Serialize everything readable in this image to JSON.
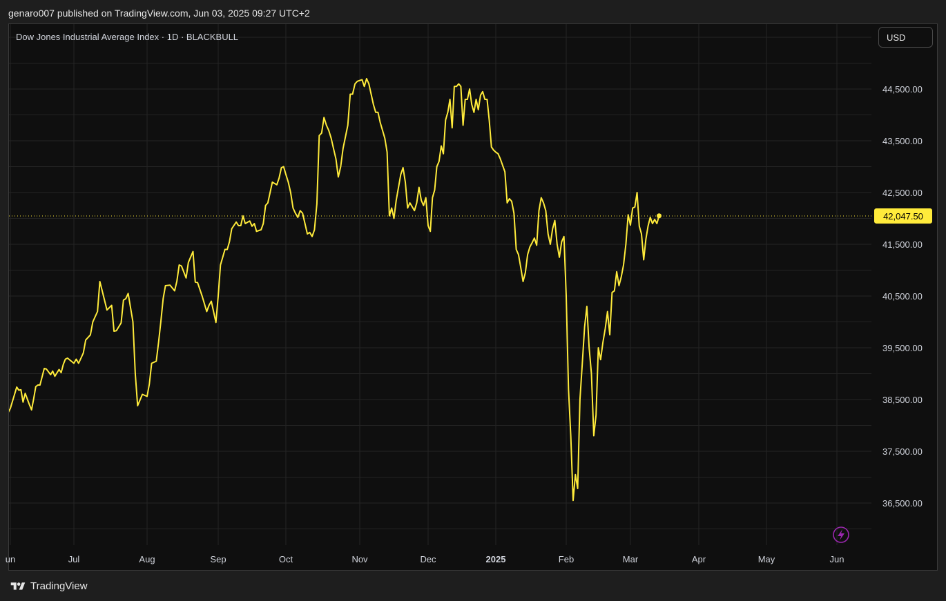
{
  "header": {
    "published_text": "genaro007 published on TradingView.com, Jun 03, 2025 09:27 UTC+2"
  },
  "chart_header": {
    "title": "Dow Jones Industrial Average Index · 1D · BLACKBULL",
    "currency": "USD"
  },
  "footer": {
    "brand": "TradingView",
    "brand_icon": "tradingview-logo-icon"
  },
  "icons": {
    "flash": "lightning-icon"
  },
  "colors": {
    "line": "#ffeb3b",
    "price_label_bg": "#ffeb3b",
    "background": "#0f0f0f",
    "grid": "#242424",
    "flash_icon": "#9c27b0"
  },
  "chart_data": {
    "type": "line",
    "title": "Dow Jones Industrial Average Index · 1D · BLACKBULL",
    "xlabel": "",
    "ylabel": "",
    "x_ticks": [
      {
        "label": "un",
        "date": "2024-06-01"
      },
      {
        "label": "Jul",
        "date": "2024-07-01"
      },
      {
        "label": "Aug",
        "date": "2024-08-01"
      },
      {
        "label": "Sep",
        "date": "2024-09-01"
      },
      {
        "label": "Oct",
        "date": "2024-10-01"
      },
      {
        "label": "Nov",
        "date": "2024-11-01"
      },
      {
        "label": "Dec",
        "date": "2024-12-01"
      },
      {
        "label": "2025",
        "date": "2025-01-01",
        "bold": true
      },
      {
        "label": "Feb",
        "date": "2025-02-01"
      },
      {
        "label": "Mar",
        "date": "2025-03-01"
      },
      {
        "label": "Apr",
        "date": "2025-04-01"
      },
      {
        "label": "May",
        "date": "2025-05-01"
      },
      {
        "label": "Jun",
        "date": "2025-06-01"
      }
    ],
    "y_ticks": [
      36500,
      37500,
      38500,
      39500,
      40500,
      41500,
      42500,
      43500,
      44500
    ],
    "y_tick_labels": [
      "36,500.00",
      "37,500.00",
      "38,500.00",
      "39,500.00",
      "40,500.00",
      "41,500.00",
      "42,500.00",
      "43,500.00",
      "44,500.00"
    ],
    "ylim": [
      35800,
      45800
    ],
    "last_price": 42047.5,
    "last_price_label": "42,047.50",
    "grid": true,
    "series": [
      {
        "points": [
          [
            "2024-05-31",
            38250
          ],
          [
            "2024-06-01",
            38330
          ],
          [
            "2024-06-03",
            38600
          ],
          [
            "2024-06-04",
            38740
          ],
          [
            "2024-06-05",
            38680
          ],
          [
            "2024-06-06",
            38690
          ],
          [
            "2024-06-07",
            38450
          ],
          [
            "2024-06-08",
            38620
          ],
          [
            "2024-06-10",
            38400
          ],
          [
            "2024-06-11",
            38300
          ],
          [
            "2024-06-12",
            38510
          ],
          [
            "2024-06-13",
            38750
          ],
          [
            "2024-06-14",
            38780
          ],
          [
            "2024-06-15",
            38780
          ],
          [
            "2024-06-17",
            39100
          ],
          [
            "2024-06-18",
            39090
          ],
          [
            "2024-06-20",
            38980
          ],
          [
            "2024-06-21",
            39050
          ],
          [
            "2024-06-22",
            38950
          ],
          [
            "2024-06-24",
            39080
          ],
          [
            "2024-06-25",
            39020
          ],
          [
            "2024-06-26",
            39180
          ],
          [
            "2024-06-27",
            39280
          ],
          [
            "2024-06-28",
            39300
          ],
          [
            "2024-07-01",
            39200
          ],
          [
            "2024-07-02",
            39280
          ],
          [
            "2024-07-03",
            39200
          ],
          [
            "2024-07-04",
            39300
          ],
          [
            "2024-07-05",
            39400
          ],
          [
            "2024-07-06",
            39650
          ],
          [
            "2024-07-08",
            39750
          ],
          [
            "2024-07-09",
            40000
          ],
          [
            "2024-07-11",
            40200
          ],
          [
            "2024-07-12",
            40780
          ],
          [
            "2024-07-13",
            40600
          ],
          [
            "2024-07-15",
            40230
          ],
          [
            "2024-07-17",
            40320
          ],
          [
            "2024-07-18",
            39820
          ],
          [
            "2024-07-19",
            39830
          ],
          [
            "2024-07-21",
            39980
          ],
          [
            "2024-07-22",
            40420
          ],
          [
            "2024-07-23",
            40450
          ],
          [
            "2024-07-24",
            40550
          ],
          [
            "2024-07-26",
            40000
          ],
          [
            "2024-07-27",
            39000
          ],
          [
            "2024-07-28",
            38380
          ],
          [
            "2024-07-30",
            38600
          ],
          [
            "2024-08-01",
            38560
          ],
          [
            "2024-08-02",
            38800
          ],
          [
            "2024-08-03",
            39200
          ],
          [
            "2024-08-05",
            39240
          ],
          [
            "2024-08-06",
            39600
          ],
          [
            "2024-08-07",
            40000
          ],
          [
            "2024-08-08",
            40450
          ],
          [
            "2024-08-09",
            40700
          ],
          [
            "2024-08-11",
            40710
          ],
          [
            "2024-08-13",
            40600
          ],
          [
            "2024-08-14",
            40790
          ],
          [
            "2024-08-15",
            41100
          ],
          [
            "2024-08-16",
            41080
          ],
          [
            "2024-08-18",
            40850
          ],
          [
            "2024-08-19",
            41150
          ],
          [
            "2024-08-21",
            41360
          ],
          [
            "2024-08-22",
            40770
          ],
          [
            "2024-08-23",
            40760
          ],
          [
            "2024-08-25",
            40500
          ],
          [
            "2024-08-27",
            40200
          ],
          [
            "2024-08-28",
            40320
          ],
          [
            "2024-08-29",
            40400
          ],
          [
            "2024-08-31",
            39990
          ],
          [
            "2024-09-01",
            40500
          ],
          [
            "2024-09-02",
            41100
          ],
          [
            "2024-09-04",
            41400
          ],
          [
            "2024-09-05",
            41400
          ],
          [
            "2024-09-06",
            41550
          ],
          [
            "2024-09-07",
            41800
          ],
          [
            "2024-09-09",
            41930
          ],
          [
            "2024-09-10",
            41860
          ],
          [
            "2024-09-11",
            41860
          ],
          [
            "2024-09-12",
            42050
          ],
          [
            "2024-09-13",
            41900
          ],
          [
            "2024-09-15",
            41950
          ],
          [
            "2024-09-16",
            41850
          ],
          [
            "2024-09-17",
            41900
          ],
          [
            "2024-09-18",
            41750
          ],
          [
            "2024-09-20",
            41780
          ],
          [
            "2024-09-21",
            41900
          ],
          [
            "2024-09-22",
            42250
          ],
          [
            "2024-09-23",
            42300
          ],
          [
            "2024-09-25",
            42700
          ],
          [
            "2024-09-27",
            42650
          ],
          [
            "2024-09-28",
            42780
          ],
          [
            "2024-09-29",
            42980
          ],
          [
            "2024-09-30",
            43000
          ],
          [
            "2024-10-01",
            42850
          ],
          [
            "2024-10-02",
            42700
          ],
          [
            "2024-10-03",
            42500
          ],
          [
            "2024-10-04",
            42200
          ],
          [
            "2024-10-05",
            42100
          ],
          [
            "2024-10-06",
            42020
          ],
          [
            "2024-10-07",
            42150
          ],
          [
            "2024-10-08",
            42100
          ],
          [
            "2024-10-10",
            41700
          ],
          [
            "2024-10-11",
            41730
          ],
          [
            "2024-10-12",
            41650
          ],
          [
            "2024-10-13",
            41780
          ],
          [
            "2024-10-14",
            42280
          ],
          [
            "2024-10-15",
            43600
          ],
          [
            "2024-10-16",
            43650
          ],
          [
            "2024-10-17",
            43950
          ],
          [
            "2024-10-18",
            43800
          ],
          [
            "2024-10-19",
            43700
          ],
          [
            "2024-10-20",
            43550
          ],
          [
            "2024-10-21",
            43350
          ],
          [
            "2024-10-22",
            43150
          ],
          [
            "2024-10-23",
            42800
          ],
          [
            "2024-10-24",
            43000
          ],
          [
            "2024-10-25",
            43350
          ],
          [
            "2024-10-27",
            43800
          ],
          [
            "2024-10-28",
            44400
          ],
          [
            "2024-10-29",
            44400
          ],
          [
            "2024-10-30",
            44600
          ],
          [
            "2024-10-31",
            44650
          ],
          [
            "2024-11-02",
            44680
          ],
          [
            "2024-11-03",
            44550
          ],
          [
            "2024-11-04",
            44700
          ],
          [
            "2024-11-05",
            44600
          ],
          [
            "2024-11-06",
            44400
          ],
          [
            "2024-11-07",
            44200
          ],
          [
            "2024-11-08",
            44050
          ],
          [
            "2024-11-09",
            44050
          ],
          [
            "2024-11-10",
            43850
          ],
          [
            "2024-11-11",
            43700
          ],
          [
            "2024-11-12",
            43550
          ],
          [
            "2024-11-13",
            43280
          ],
          [
            "2024-11-14",
            42050
          ],
          [
            "2024-11-15",
            42200
          ],
          [
            "2024-11-16",
            42000
          ],
          [
            "2024-11-17",
            42350
          ],
          [
            "2024-11-19",
            42850
          ],
          [
            "2024-11-20",
            42980
          ],
          [
            "2024-11-21",
            42700
          ],
          [
            "2024-11-22",
            42200
          ],
          [
            "2024-11-23",
            42300
          ],
          [
            "2024-11-25",
            42150
          ],
          [
            "2024-11-26",
            42300
          ],
          [
            "2024-11-27",
            42600
          ],
          [
            "2024-11-28",
            42350
          ],
          [
            "2024-11-29",
            42250
          ],
          [
            "2024-11-30",
            42400
          ],
          [
            "2024-12-01",
            41860
          ],
          [
            "2024-12-02",
            41750
          ],
          [
            "2024-12-03",
            42400
          ],
          [
            "2024-12-04",
            42550
          ],
          [
            "2024-12-05",
            43000
          ],
          [
            "2024-12-06",
            43100
          ],
          [
            "2024-12-07",
            43400
          ],
          [
            "2024-12-08",
            43250
          ],
          [
            "2024-12-09",
            43900
          ],
          [
            "2024-12-10",
            44050
          ],
          [
            "2024-12-11",
            44300
          ],
          [
            "2024-12-12",
            43750
          ],
          [
            "2024-12-13",
            44550
          ],
          [
            "2024-12-14",
            44550
          ],
          [
            "2024-12-15",
            44600
          ],
          [
            "2024-12-16",
            44550
          ],
          [
            "2024-12-17",
            43800
          ],
          [
            "2024-12-18",
            44300
          ],
          [
            "2024-12-19",
            44300
          ],
          [
            "2024-12-20",
            44500
          ],
          [
            "2024-12-21",
            44200
          ],
          [
            "2024-12-22",
            44050
          ],
          [
            "2024-12-23",
            44300
          ],
          [
            "2024-12-24",
            44100
          ],
          [
            "2024-12-25",
            44380
          ],
          [
            "2024-12-26",
            44450
          ],
          [
            "2024-12-27",
            44300
          ],
          [
            "2024-12-28",
            44300
          ],
          [
            "2024-12-29",
            43900
          ],
          [
            "2024-12-30",
            43380
          ],
          [
            "2024-12-31",
            43320
          ],
          [
            "2025-01-01",
            43280
          ],
          [
            "2025-01-02",
            43250
          ],
          [
            "2025-01-03",
            43150
          ],
          [
            "2025-01-05",
            42900
          ],
          [
            "2025-01-06",
            42300
          ],
          [
            "2025-01-07",
            42380
          ],
          [
            "2025-01-08",
            42330
          ],
          [
            "2025-01-09",
            42100
          ],
          [
            "2025-01-10",
            41400
          ],
          [
            "2025-01-11",
            41300
          ],
          [
            "2025-01-12",
            41050
          ],
          [
            "2025-01-13",
            40780
          ],
          [
            "2025-01-14",
            40950
          ],
          [
            "2025-01-15",
            41300
          ],
          [
            "2025-01-16",
            41450
          ],
          [
            "2025-01-17",
            41530
          ],
          [
            "2025-01-18",
            41620
          ],
          [
            "2025-01-19",
            41480
          ],
          [
            "2025-01-20",
            42150
          ],
          [
            "2025-01-21",
            42400
          ],
          [
            "2025-01-22",
            42300
          ],
          [
            "2025-01-23",
            42150
          ],
          [
            "2025-01-24",
            41700
          ],
          [
            "2025-01-25",
            41500
          ],
          [
            "2025-01-26",
            41800
          ],
          [
            "2025-01-27",
            41960
          ],
          [
            "2025-01-28",
            41500
          ],
          [
            "2025-01-29",
            41250
          ],
          [
            "2025-01-30",
            41550
          ],
          [
            "2025-01-31",
            41650
          ],
          [
            "2025-02-01",
            40500
          ],
          [
            "2025-02-02",
            38700
          ],
          [
            "2025-02-03",
            37800
          ],
          [
            "2025-02-04",
            36550
          ],
          [
            "2025-02-05",
            37050
          ],
          [
            "2025-02-06",
            36780
          ],
          [
            "2025-02-07",
            38500
          ],
          [
            "2025-02-08",
            39200
          ],
          [
            "2025-02-09",
            39900
          ],
          [
            "2025-02-10",
            40300
          ],
          [
            "2025-02-11",
            39500
          ],
          [
            "2025-02-12",
            39000
          ],
          [
            "2025-02-13",
            37800
          ],
          [
            "2025-02-14",
            38200
          ],
          [
            "2025-02-15",
            39500
          ],
          [
            "2025-02-16",
            39270
          ],
          [
            "2025-02-17",
            39600
          ],
          [
            "2025-02-18",
            39870
          ],
          [
            "2025-02-19",
            40200
          ],
          [
            "2025-02-20",
            39750
          ],
          [
            "2025-02-21",
            40570
          ],
          [
            "2025-02-22",
            40600
          ],
          [
            "2025-02-23",
            40970
          ],
          [
            "2025-02-24",
            40700
          ],
          [
            "2025-02-25",
            40870
          ],
          [
            "2025-02-26",
            41100
          ],
          [
            "2025-02-27",
            41500
          ],
          [
            "2025-02-28",
            42070
          ],
          [
            "2025-03-01",
            41870
          ],
          [
            "2025-03-02",
            42200
          ],
          [
            "2025-03-03",
            42220
          ],
          [
            "2025-03-04",
            42500
          ],
          [
            "2025-03-05",
            41850
          ],
          [
            "2025-03-06",
            41700
          ],
          [
            "2025-03-07",
            41200
          ],
          [
            "2025-03-08",
            41600
          ],
          [
            "2025-03-09",
            41850
          ],
          [
            "2025-03-10",
            42020
          ],
          [
            "2025-03-11",
            41900
          ],
          [
            "2025-03-12",
            41980
          ],
          [
            "2025-03-13",
            41900
          ],
          [
            "2025-03-14",
            42050
          ]
        ]
      }
    ]
  }
}
